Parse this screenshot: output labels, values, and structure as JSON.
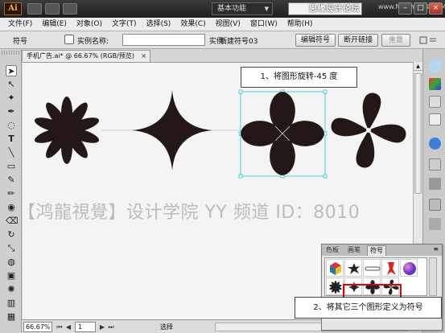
{
  "app": {
    "logo": "Ai",
    "workspace": "基本功能",
    "watermark": "思缘设计论坛",
    "watermark_url": "www.MISSYUAN.COM"
  },
  "menu": [
    "文件(F)",
    "编辑(E)",
    "对象(O)",
    "文字(T)",
    "选择(S)",
    "效果(C)",
    "视图(V)",
    "窗口(W)",
    "帮助(H)"
  ],
  "control": {
    "label": "符号",
    "instance_name_label": "实例名称:",
    "instance_name_value": "",
    "instance_label": "实例:",
    "instance_value": "新建符号03",
    "edit_symbol": "编辑符号",
    "break_link": "断开链接",
    "reset": "重置"
  },
  "document": {
    "tab_title": "手机广告.ai* @ 66.67% (RGB/预览)",
    "tab_close": "×"
  },
  "status": {
    "zoom": "66.67%",
    "page": "1",
    "status_text": "选择"
  },
  "canvas_watermark": "【鸿龍視覺】设计学院  YY 频道 ID：8010",
  "callouts": {
    "step1": "1、将图形旋转-45 度",
    "step2": "2、将其它三个图形定义为符号"
  },
  "symbols_panel": {
    "tabs": [
      "色板",
      "画笔",
      "符号"
    ],
    "active_tab": "符号",
    "menu_icon": "≡",
    "symbols": [
      "cube-symbol",
      "splat-symbol",
      "chain-symbol",
      "ribbon-symbol",
      "sphere-symbol",
      "flower-symbol",
      "sparkle-symbol",
      "clover-symbol",
      "pinwheel-symbol"
    ]
  },
  "colors": {
    "shape_fill": "#231815",
    "selection": "#22c4d6",
    "highlight_box": "#e00000"
  }
}
